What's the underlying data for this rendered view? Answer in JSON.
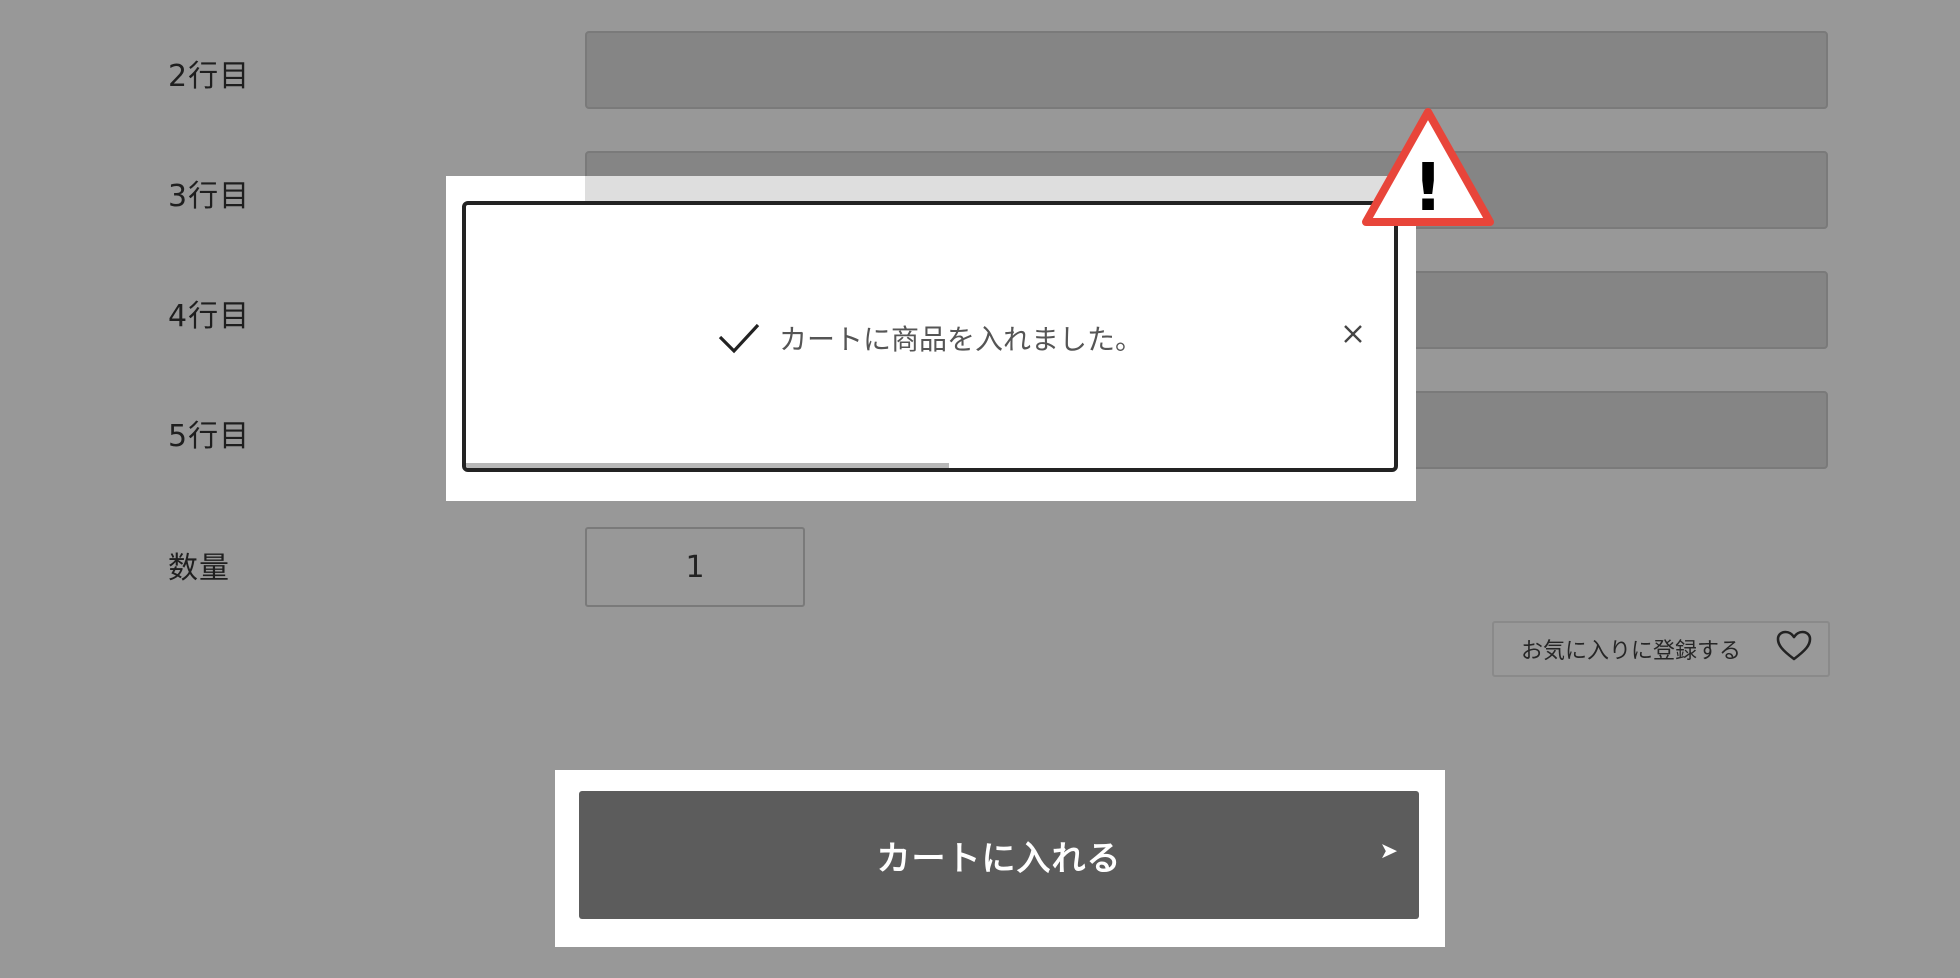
{
  "rows": [
    {
      "label": "2行目"
    },
    {
      "label": "3行目"
    },
    {
      "label": "4行目"
    },
    {
      "label": "5行目"
    }
  ],
  "quantity": {
    "label": "数量",
    "value": "1"
  },
  "favorite": {
    "label": "お気に入りに登録する",
    "icon": "heart-icon"
  },
  "cart": {
    "label": "カートに入れる",
    "arrow": "➤"
  },
  "toast": {
    "message": "カートに商品を入れました。",
    "icon": "check-icon",
    "close": "×",
    "progress": 0.52
  },
  "warning": {
    "icon": "warning-icon",
    "mark": "!",
    "color": "#e8453a"
  }
}
